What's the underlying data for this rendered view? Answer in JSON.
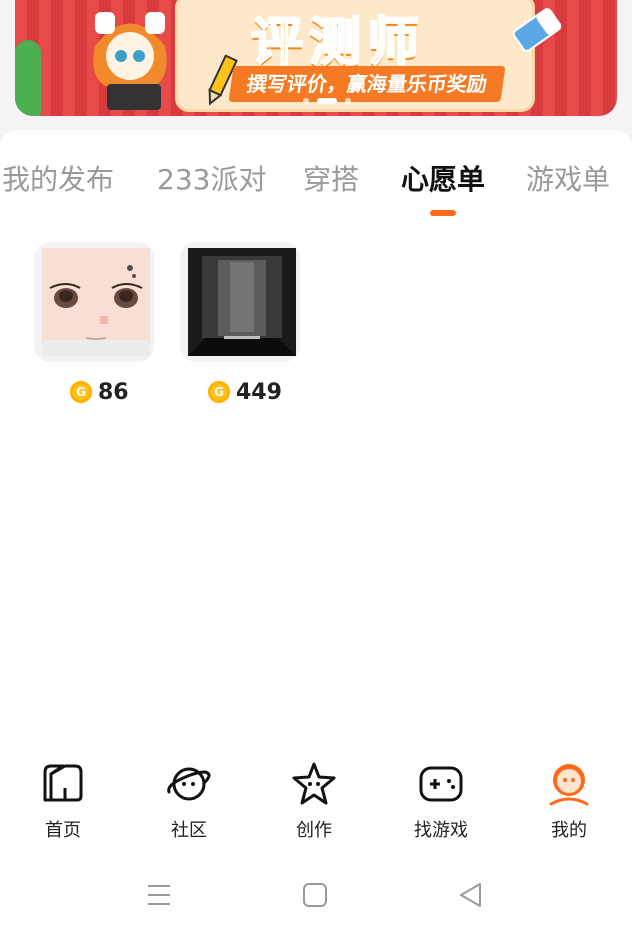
{
  "banner": {
    "title": "评测师",
    "subtitle": "撰写评价，赢海量乐币奖励",
    "page_count": 3,
    "active_page": 2
  },
  "tabs": [
    {
      "label": "我的发布",
      "active": false
    },
    {
      "label": "233派对",
      "active": false
    },
    {
      "label": "穿搭",
      "active": false
    },
    {
      "label": "心愿单",
      "active": true
    },
    {
      "label": "游戏单",
      "active": false
    }
  ],
  "wishlist": [
    {
      "thumbnail": "face-skin",
      "price": "86",
      "currency_icon": "coin-icon"
    },
    {
      "thumbnail": "dark-room",
      "price": "449",
      "currency_icon": "coin-icon"
    }
  ],
  "bottom_nav": [
    {
      "label": "首页",
      "icon": "home-icon",
      "active": false
    },
    {
      "label": "社区",
      "icon": "planet-icon",
      "active": false
    },
    {
      "label": "创作",
      "icon": "star-icon",
      "active": false
    },
    {
      "label": "找游戏",
      "icon": "gamepad-icon",
      "active": false
    },
    {
      "label": "我的",
      "icon": "profile-icon",
      "active": true
    }
  ],
  "system_nav": [
    "menu-icon",
    "home-square-icon",
    "back-icon"
  ],
  "colors": {
    "accent": "#ff6a1a",
    "active_tab": "#111111",
    "inactive_tab": "#9a9a9a",
    "coin": "#ffc21a",
    "banner_red": "#e84a4a"
  }
}
